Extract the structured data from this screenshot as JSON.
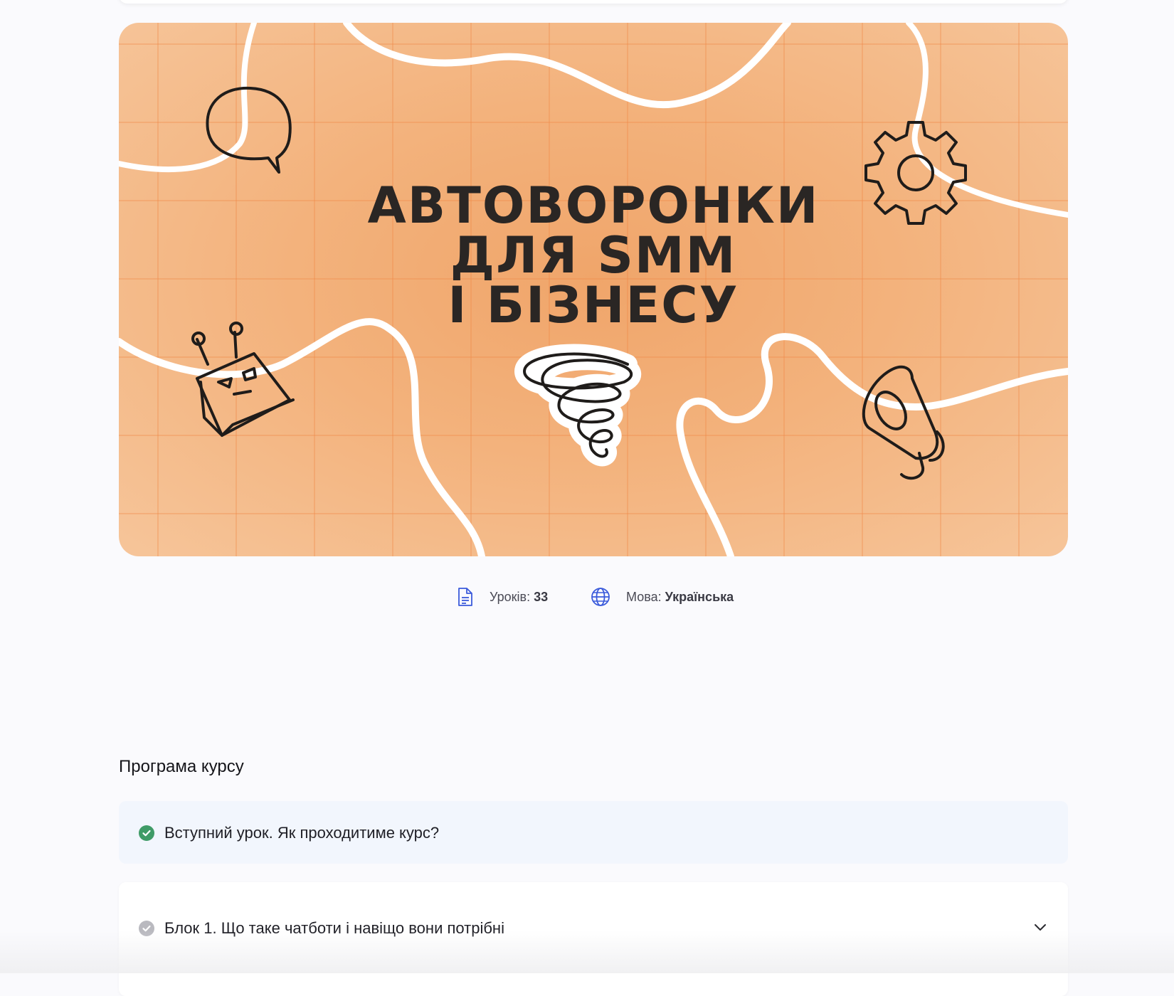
{
  "hero": {
    "title_lines": [
      "АВТОВОРОНКИ",
      "ДЛЯ SMM",
      "І БІЗНЕСУ"
    ],
    "background_color": "#f3b27c",
    "decor_icons": [
      "speech-bubble-icon",
      "gear-icon",
      "robot-icon",
      "tornado-icon",
      "megaphone-icon"
    ]
  },
  "meta": {
    "lessons_label": "Уроків:",
    "lessons_value": "33",
    "language_label": "Мова:",
    "language_value": "Українська",
    "icons": [
      "document-icon",
      "globe-icon"
    ],
    "icon_color": "#3b5bdb"
  },
  "program": {
    "title": "Програма курсу",
    "intro_lesson": {
      "label": "Вступний урок. Як проходитиме курс?",
      "status": "completed",
      "status_color": "#3f9b67"
    },
    "blocks": [
      {
        "label": "Блок 1. Що таке чатботи і навіщо вони потрібні",
        "status": "incomplete",
        "status_color": "#b9b9bf",
        "expanded": false
      }
    ]
  }
}
